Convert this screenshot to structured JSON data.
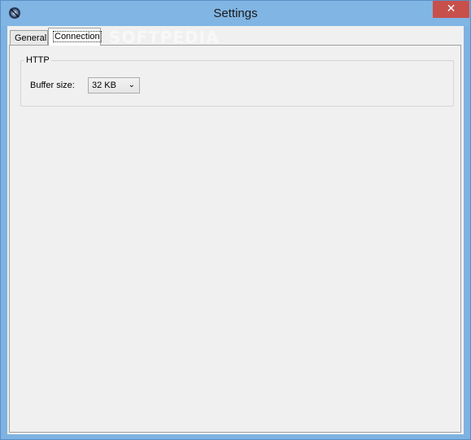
{
  "window": {
    "title": "Settings",
    "close_glyph": "✕",
    "app_icon": "app-icon"
  },
  "tabs": [
    {
      "label": "General",
      "selected": false
    },
    {
      "label": "Connection",
      "selected": true
    }
  ],
  "http_group": {
    "label": "HTTP",
    "buffer_size": {
      "label": "Buffer size:",
      "value": "32 KB",
      "arrow_glyph": "⌄"
    }
  },
  "watermark": "SOFTPEDIA"
}
